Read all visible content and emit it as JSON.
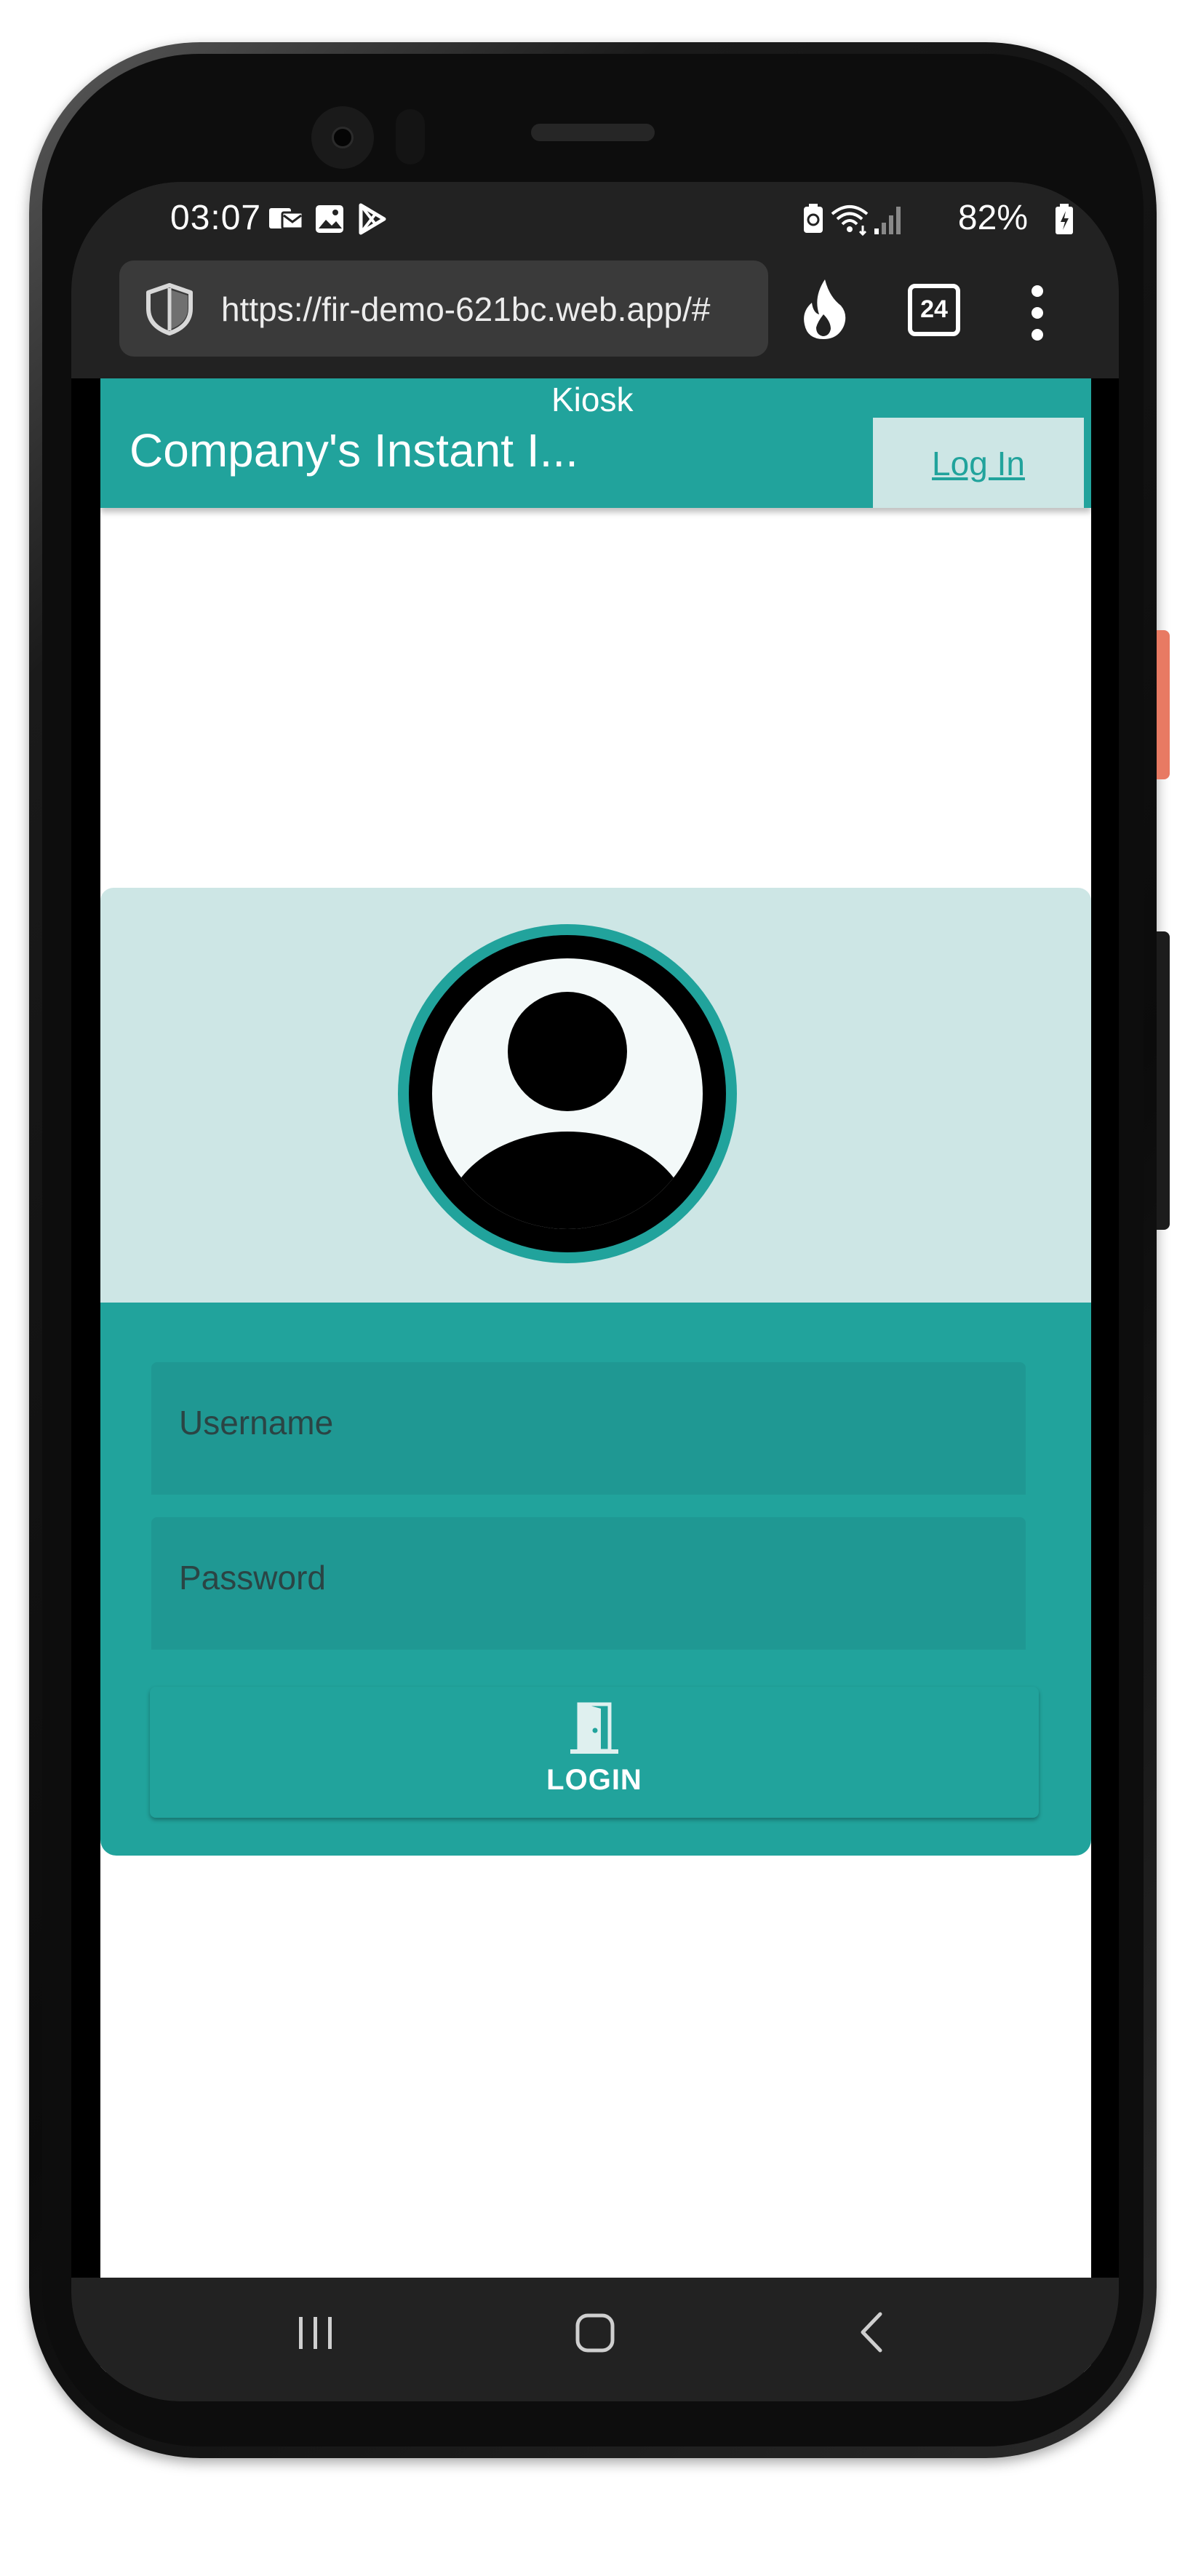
{
  "status_bar": {
    "time": "03:07",
    "battery": "82%",
    "icons": [
      "notification-icon",
      "gallery-icon",
      "play-store-icon",
      "battery-saver-icon",
      "wifi-icon",
      "signal-icon",
      "battery-charging-icon"
    ]
  },
  "browser": {
    "url": "https://fir-demo-621bc.web.app/#",
    "tab_count": "24",
    "icons": [
      "shield-icon",
      "flame-icon",
      "tabs-icon",
      "more-menu-icon"
    ]
  },
  "app_bar": {
    "subtitle": "Kiosk",
    "title": "Company's Instant I...",
    "login_link": "Log In"
  },
  "login_form": {
    "username_placeholder": "Username",
    "password_placeholder": "Password",
    "login_button": "LOGIN"
  },
  "nav_bar": {
    "icons": [
      "recents-icon",
      "home-icon",
      "back-icon"
    ]
  },
  "colors": {
    "accent": "#21a39c",
    "accent_light": "#cde6e5",
    "field_bg": "#1f9893",
    "status_bar": "#222222"
  }
}
